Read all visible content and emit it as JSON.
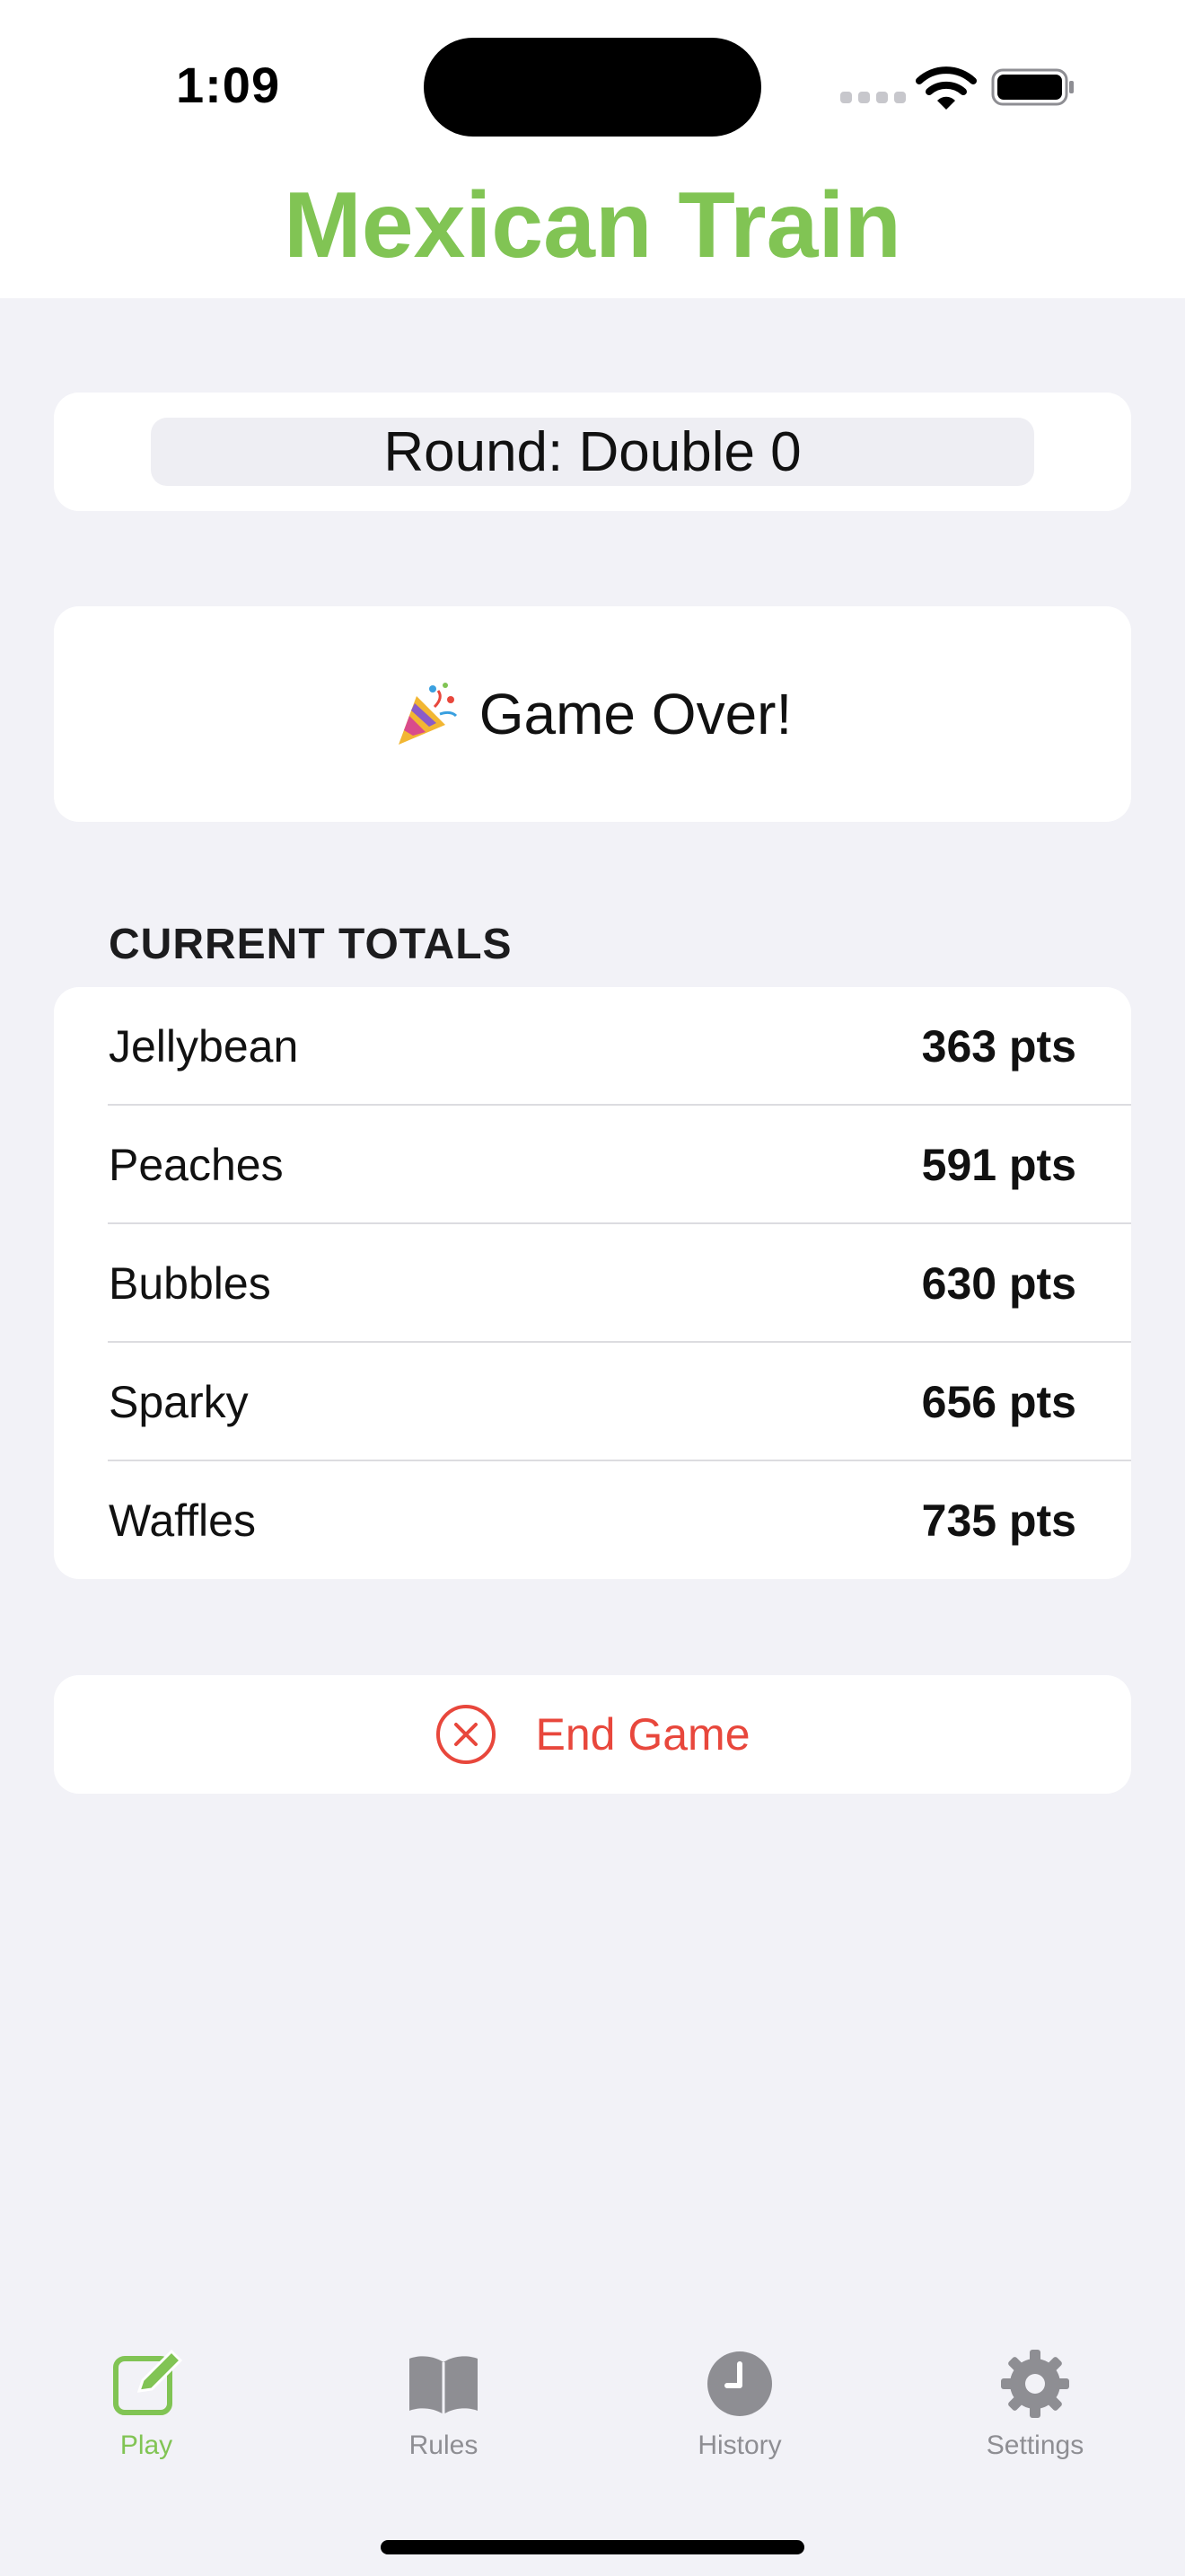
{
  "status_bar": {
    "time": "1:09"
  },
  "app": {
    "title": "Mexican Train"
  },
  "round": {
    "label": "Round: Double 0"
  },
  "game_over": {
    "label": "Game Over!",
    "icon": "party-popper-icon"
  },
  "totals": {
    "header": "CURRENT TOTALS",
    "rows": [
      {
        "name": "Jellybean",
        "points": "363 pts"
      },
      {
        "name": "Peaches",
        "points": "591 pts"
      },
      {
        "name": "Bubbles",
        "points": "630 pts"
      },
      {
        "name": "Sparky",
        "points": "656 pts"
      },
      {
        "name": "Waffles",
        "points": "735 pts"
      }
    ]
  },
  "end_game": {
    "label": "End Game",
    "icon": "x-circle-icon",
    "color": "#e8473c"
  },
  "tabs": [
    {
      "label": "Play",
      "icon": "pencil-square-icon",
      "active": true
    },
    {
      "label": "Rules",
      "icon": "book-icon",
      "active": false
    },
    {
      "label": "History",
      "icon": "clock-icon",
      "active": false
    },
    {
      "label": "Settings",
      "icon": "gear-icon",
      "active": false
    }
  ],
  "colors": {
    "accent": "#81c454",
    "background": "#f2f2f7",
    "destructive": "#e8473c",
    "inactive_tab": "#8e8e93"
  }
}
